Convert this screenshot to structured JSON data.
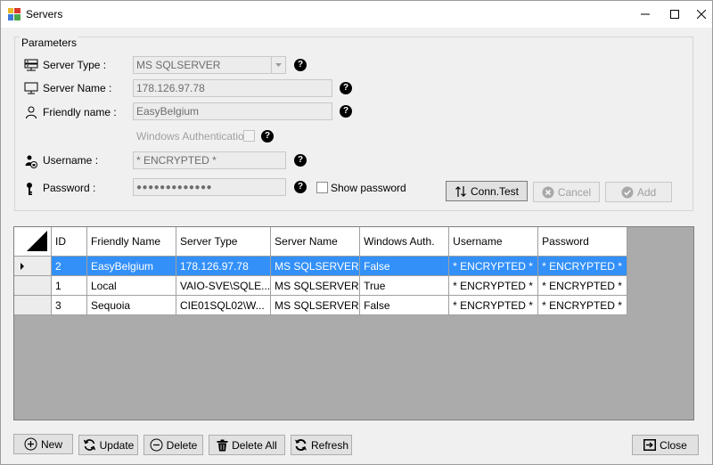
{
  "window": {
    "title": "Servers"
  },
  "parameters": {
    "legend": "Parameters",
    "server_type": {
      "label": "Server Type :",
      "value": "MS SQLSERVER"
    },
    "server_name": {
      "label": "Server Name :",
      "value": "178.126.97.78"
    },
    "friendly_name": {
      "label": "Friendly name :",
      "value": "EasyBelgium"
    },
    "windows_auth": {
      "label": "Windows Authentication",
      "checked": false
    },
    "username": {
      "label": "Username :",
      "value": "* ENCRYPTED *"
    },
    "password": {
      "label": "Password :",
      "value": "●●●●●●●●●●●●●"
    },
    "show_password": {
      "label": "Show password",
      "checked": false
    },
    "help_glyph": "?"
  },
  "actions": {
    "conn_test": "Conn.Test",
    "cancel": "Cancel",
    "add": "Add"
  },
  "grid": {
    "columns": [
      "ID",
      "Friendly Name",
      "Server Type",
      "Server Name",
      "Windows Auth.",
      "Username",
      "Password"
    ],
    "rows": [
      {
        "id": "2",
        "friendly": "EasyBelgium",
        "server_type": "178.126.97.78",
        "server_name": "MS SQLSERVER",
        "win_auth": "False",
        "username": "* ENCRYPTED *",
        "password": "* ENCRYPTED *"
      },
      {
        "id": "1",
        "friendly": "Local",
        "server_type": "VAIO-SVE\\SQLE...",
        "server_name": "MS SQLSERVER",
        "win_auth": "True",
        "username": "* ENCRYPTED *",
        "password": "* ENCRYPTED *"
      },
      {
        "id": "3",
        "friendly": "Sequoia",
        "server_type": "CIE01SQL02\\W...",
        "server_name": "MS SQLSERVER",
        "win_auth": "False",
        "username": "* ENCRYPTED *",
        "password": "* ENCRYPTED *"
      }
    ],
    "selected_row": 0
  },
  "footer": {
    "new": "New",
    "update": "Update",
    "delete": "Delete",
    "delete_all": "Delete All",
    "refresh": "Refresh",
    "close": "Close"
  },
  "colors": {
    "selection": "#3390f9",
    "grid_background": "#ababab"
  },
  "icons": {
    "app": "servers-app-icon",
    "server_type": "server-rack-icon",
    "server_name": "monitor-icon",
    "friendly_name": "user-icon",
    "username": "user-lock-icon",
    "password": "key-icon",
    "conn_test": "up-down-arrows-icon",
    "cancel": "cancel-circle-icon",
    "add": "check-circle-icon",
    "new": "plus-circle-icon",
    "update": "sync-icon",
    "delete": "minus-circle-icon",
    "delete_all": "trash-icon",
    "refresh": "refresh-icon",
    "close": "exit-icon"
  }
}
